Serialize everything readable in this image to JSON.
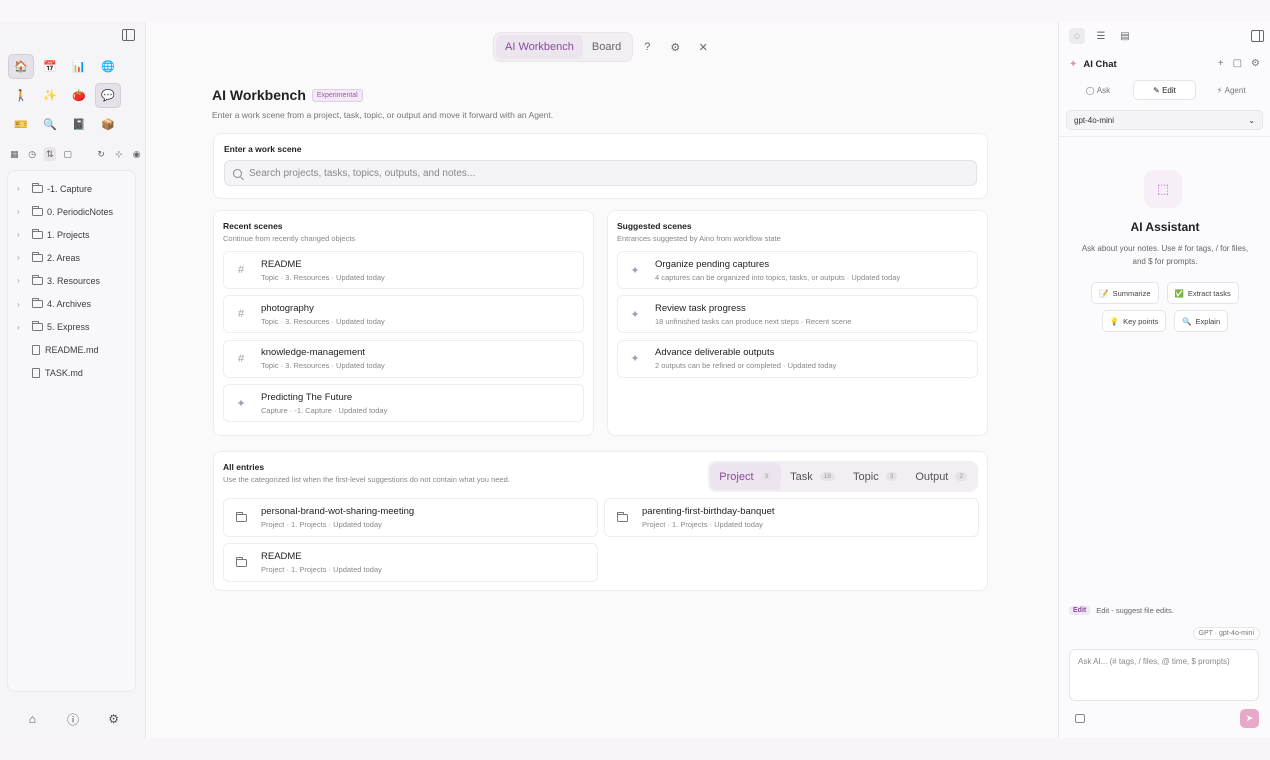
{
  "left_sidebar": {
    "apps": [
      {
        "icon": "home-icon",
        "glyph": "🏠"
      },
      {
        "icon": "calendar-icon",
        "glyph": "📅"
      },
      {
        "icon": "chart-icon",
        "glyph": "📊"
      },
      {
        "icon": "globe-icon",
        "glyph": "🌐"
      },
      {
        "icon": "person-icon",
        "glyph": "🚶"
      },
      {
        "icon": "sparkle-icon",
        "glyph": "✨"
      },
      {
        "icon": "tomato-icon",
        "glyph": "🍅"
      },
      {
        "icon": "chat-icon",
        "glyph": "💬"
      },
      {
        "icon": "ticket-icon",
        "glyph": "🎫"
      },
      {
        "icon": "magnifier-icon",
        "glyph": "🔍"
      },
      {
        "icon": "book-icon",
        "glyph": "📓"
      },
      {
        "icon": "box-icon",
        "glyph": "📦"
      }
    ],
    "tree": [
      {
        "label": "-1. Capture",
        "type": "folder"
      },
      {
        "label": "0. PeriodicNotes",
        "type": "folder"
      },
      {
        "label": "1. Projects",
        "type": "folder"
      },
      {
        "label": "2. Areas",
        "type": "folder"
      },
      {
        "label": "3. Resources",
        "type": "folder"
      },
      {
        "label": "4. Archives",
        "type": "folder"
      },
      {
        "label": "5. Express",
        "type": "folder"
      },
      {
        "label": "README.md",
        "type": "file"
      },
      {
        "label": "TASK.md",
        "type": "file"
      }
    ]
  },
  "tabs": {
    "workbench": "AI Workbench",
    "board": "Board"
  },
  "workbench": {
    "title": "AI Workbench",
    "badge": "Experimental",
    "subtitle": "Enter a work scene from a project, task, topic, or output and move it forward with an Agent."
  },
  "scene_input": {
    "label": "Enter a work scene",
    "placeholder": "Search projects, tasks, topics, outputs, and notes..."
  },
  "recent": {
    "title": "Recent scenes",
    "hint": "Continue from recently changed objects",
    "items": [
      {
        "title": "README",
        "meta": "Topic · 3. Resources · Updated today",
        "icon": "#"
      },
      {
        "title": "photography",
        "meta": "Topic · 3. Resources · Updated today",
        "icon": "#"
      },
      {
        "title": "knowledge-management",
        "meta": "Topic · 3. Resources · Updated today",
        "icon": "#"
      },
      {
        "title": "Predicting The Future",
        "meta": "Capture · -1. Capture · Updated today",
        "icon": "✦"
      }
    ]
  },
  "suggested": {
    "title": "Suggested scenes",
    "hint": "Entrances suggested by Aino from workflow state",
    "items": [
      {
        "title": "Organize pending captures",
        "meta": "4 captures can be organized into topics, tasks, or outputs · Updated today"
      },
      {
        "title": "Review task progress",
        "meta": "18 unfinished tasks can produce next steps · Recent scene"
      },
      {
        "title": "Advance deliverable outputs",
        "meta": "2 outputs can be refined or completed · Updated today"
      }
    ]
  },
  "entries": {
    "title": "All entries",
    "hint": "Use the categorized list when the first-level suggestions do not contain what you need.",
    "segments": [
      {
        "label": "Project",
        "count": "3"
      },
      {
        "label": "Task",
        "count": "18"
      },
      {
        "label": "Topic",
        "count": "3"
      },
      {
        "label": "Output",
        "count": "2"
      }
    ],
    "items": [
      {
        "title": "personal-brand-wot-sharing-meeting",
        "meta": "Project · 1. Projects · Updated today"
      },
      {
        "title": "parenting-first-birthday-banquet",
        "meta": "Project · 1. Projects · Updated today"
      },
      {
        "title": "README",
        "meta": "Project · 1. Projects · Updated today"
      }
    ]
  },
  "chat": {
    "title": "AI Chat",
    "modes": [
      "Ask",
      "Edit",
      "Agent"
    ],
    "model": "gpt-4o-mini",
    "assistant_title": "AI Assistant",
    "assistant_desc": "Ask about your notes. Use # for tags, / for files, and $ for prompts.",
    "chips": [
      {
        "label": "Summarize",
        "glyph": "📝"
      },
      {
        "label": "Extract tasks",
        "glyph": "✅"
      },
      {
        "label": "Key points",
        "glyph": "💡"
      },
      {
        "label": "Explain",
        "glyph": "🔍"
      }
    ],
    "edit_tag": "Edit",
    "edit_hint": "Edit - suggest file edits.",
    "model_pill": "GPT · gpt-4o-mini",
    "input_placeholder": "Ask AI... (# tags, / files, @ time, $ prompts)"
  }
}
